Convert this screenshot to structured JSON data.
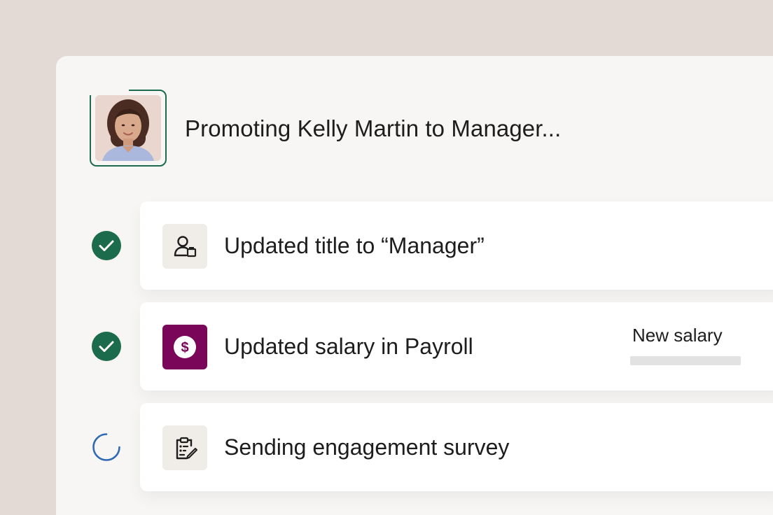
{
  "header": {
    "title": "Promoting Kelly Martin to Manager...",
    "avatar_icon": "person-photo"
  },
  "steps": [
    {
      "label": "Updated title to “Manager”",
      "status": "complete",
      "status_icon": "check-circle-icon",
      "icon": "user-badge-icon"
    },
    {
      "label": "Updated salary in Payroll",
      "status": "complete",
      "status_icon": "check-circle-icon",
      "icon": "dollar-icon",
      "side_label": "New salary"
    },
    {
      "label": "Sending engagement survey",
      "status": "in-progress",
      "status_icon": "spinner-icon",
      "icon": "clipboard-edit-icon"
    }
  ],
  "colors": {
    "background": "#e3dad5",
    "panel": "#f7f6f4",
    "success_green": "#1c6b4c",
    "payroll_purple": "#7a0659",
    "progress_blue": "#2f6ab4"
  }
}
